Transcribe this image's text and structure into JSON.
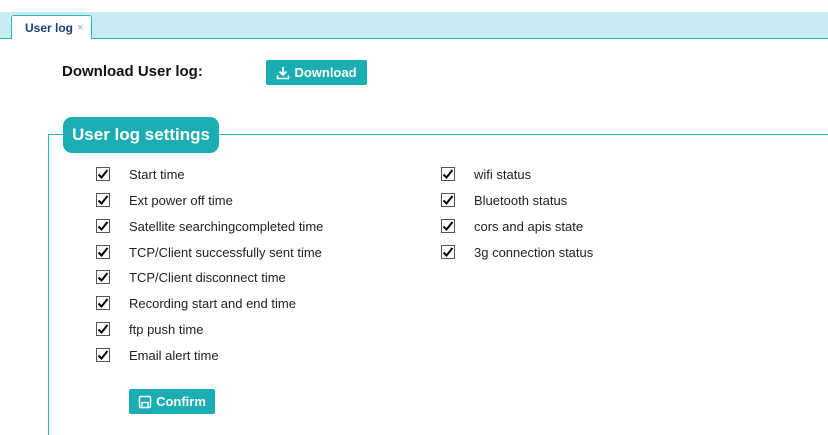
{
  "tabs": [
    {
      "label": "User log",
      "close": "×"
    }
  ],
  "download": {
    "label": "Download User log:",
    "button": "Download"
  },
  "settings": {
    "title": "User log settings",
    "col1": [
      {
        "label": "Start time",
        "checked": true
      },
      {
        "label": "Ext power off time",
        "checked": true
      },
      {
        "label": "Satellite searchingcompleted time",
        "checked": true
      },
      {
        "label": "TCP/Client successfully sent time",
        "checked": true
      },
      {
        "label": "TCP/Client disconnect time",
        "checked": true
      },
      {
        "label": "Recording start and end time",
        "checked": true
      },
      {
        "label": "ftp push time",
        "checked": true
      },
      {
        "label": "Email alert time",
        "checked": true
      }
    ],
    "col2": [
      {
        "label": "wifi status",
        "checked": true
      },
      {
        "label": "Bluetooth status",
        "checked": true
      },
      {
        "label": "cors and apis state",
        "checked": true
      },
      {
        "label": "3g connection status",
        "checked": true
      }
    ],
    "confirm": "Confirm"
  },
  "colors": {
    "accent": "#1aaeb3",
    "tabbar": "#c8ecef"
  }
}
